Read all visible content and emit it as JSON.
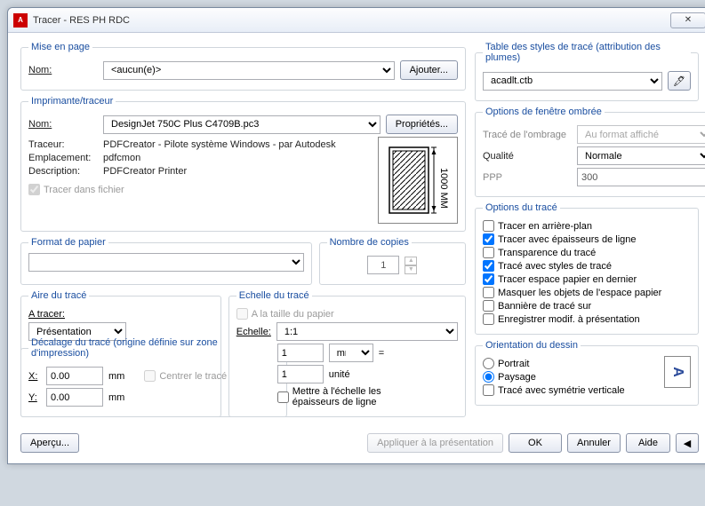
{
  "window": {
    "title": "Tracer - RES PH RDC"
  },
  "mise_en_page": {
    "legend": "Mise en page",
    "nom_label": "Nom:",
    "nom_value": "<aucun(e)>",
    "ajouter": "Ajouter..."
  },
  "imprimante": {
    "legend": "Imprimante/traceur",
    "nom_label": "Nom:",
    "nom_value": "DesignJet 750C Plus C4709B.pc3",
    "proprietes": "Propriétés...",
    "traceur_label": "Traceur:",
    "traceur_value": "PDFCreator - Pilote système Windows - par Autodesk",
    "emplacement_label": "Emplacement:",
    "emplacement_value": "pdfcmon",
    "description_label": "Description:",
    "description_value": "PDFCreator Printer",
    "tracer_fichier": "Tracer dans fichier",
    "preview_dim": "1000 MM"
  },
  "papier": {
    "legend": "Format de papier",
    "value": ""
  },
  "copies": {
    "legend": "Nombre de copies",
    "value": "1"
  },
  "aire": {
    "legend": "Aire du tracé",
    "a_tracer": "A tracer:",
    "value": "Présentation"
  },
  "echelle": {
    "legend": "Echelle du tracé",
    "taille_papier": "A la taille du papier",
    "echelle_label": "Echelle:",
    "echelle_value": "1:1",
    "num": "1",
    "unit": "mm",
    "denom": "1",
    "unite": "unité",
    "mettre": "Mettre à l'échelle les épaisseurs de ligne"
  },
  "decalage": {
    "legend": "Décalage du tracé (origine définie sur zone d'impression)",
    "x_label": "X:",
    "y_label": "Y:",
    "x_value": "0.00",
    "y_value": "0.00",
    "mm": "mm",
    "centrer": "Centrer le tracé"
  },
  "table_styles": {
    "legend": "Table des styles de tracé (attribution des plumes)",
    "value": "acadlt.ctb"
  },
  "fenetre_ombree": {
    "legend": "Options de fenêtre ombrée",
    "trace_label": "Tracé de l'ombrage",
    "trace_value": "Au format affiché",
    "qualite_label": "Qualité",
    "qualite_value": "Normale",
    "ppp_label": "PPP",
    "ppp_value": "300"
  },
  "options_trace": {
    "legend": "Options du tracé",
    "opts": [
      {
        "label": "Tracer en arrière-plan",
        "checked": false,
        "enabled": true
      },
      {
        "label": "Tracer avec épaisseurs de ligne",
        "checked": true,
        "enabled": true
      },
      {
        "label": "Transparence du tracé",
        "checked": false,
        "enabled": true
      },
      {
        "label": "Tracé avec styles de tracé",
        "checked": true,
        "enabled": true
      },
      {
        "label": "Tracer espace papier en dernier",
        "checked": true,
        "enabled": true
      },
      {
        "label": "Masquer les objets de l'espace papier",
        "checked": false,
        "enabled": true
      },
      {
        "label": "Bannière de tracé sur",
        "checked": false,
        "enabled": true
      },
      {
        "label": "Enregistrer modif. à présentation",
        "checked": false,
        "enabled": true
      }
    ]
  },
  "orientation": {
    "legend": "Orientation du dessin",
    "portrait": "Portrait",
    "paysage": "Paysage",
    "symetrie": "Tracé avec symétrie verticale"
  },
  "footer": {
    "apercu": "Aperçu...",
    "appliquer": "Appliquer à la présentation",
    "ok": "OK",
    "annuler": "Annuler",
    "aide": "Aide"
  }
}
